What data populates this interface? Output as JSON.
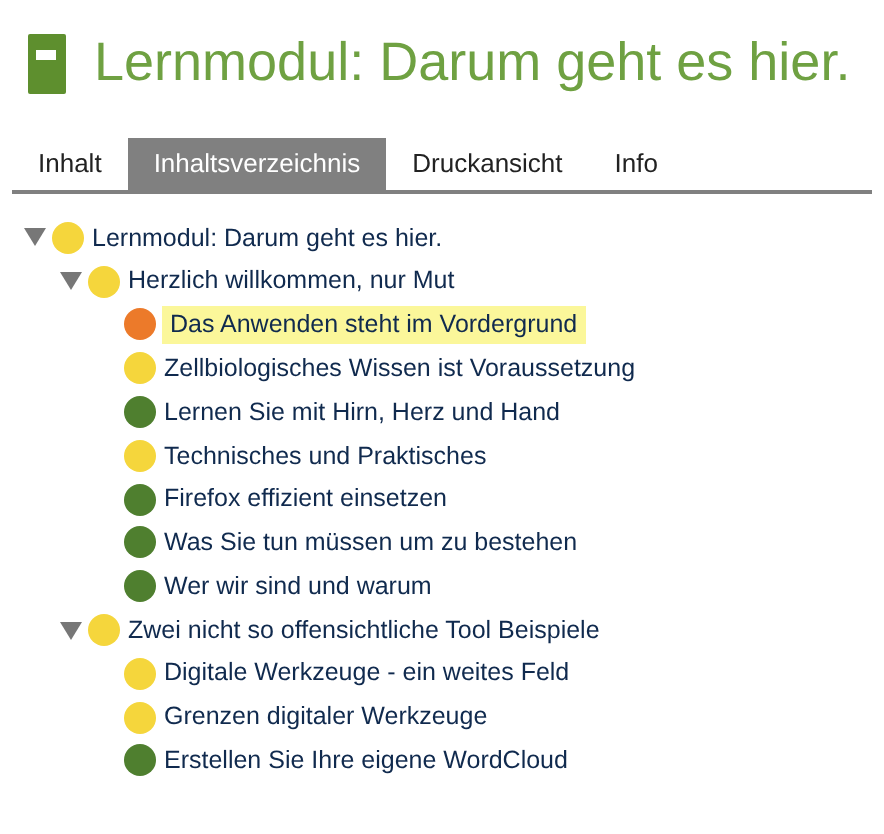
{
  "title": "Lernmodul: Darum geht es hier.",
  "tabs": [
    {
      "label": "Inhalt",
      "selected": false
    },
    {
      "label": "Inhaltsverzeichnis",
      "selected": true
    },
    {
      "label": "Druckansicht",
      "selected": false
    },
    {
      "label": "Info",
      "selected": false
    }
  ],
  "tree": [
    {
      "label": "Lernmodul: Darum geht es hier.",
      "color": "#f5d63c",
      "expanded": true,
      "selected": false,
      "children": [
        {
          "label": "Herzlich willkommen, nur Mut",
          "color": "#f5d63c",
          "expanded": true,
          "selected": false,
          "children": [
            {
              "label": "Das Anwenden steht im Vordergrund",
              "color": "#ec7a2a",
              "selected": true
            },
            {
              "label": "Zellbiologisches Wissen ist Voraussetzung",
              "color": "#f5d63c",
              "selected": false
            },
            {
              "label": "Lernen Sie mit Hirn, Herz und Hand",
              "color": "#4f7f2f",
              "selected": false
            },
            {
              "label": "Technisches und Praktisches",
              "color": "#f5d63c",
              "selected": false
            },
            {
              "label": "Firefox effizient einsetzen",
              "color": "#4f7f2f",
              "selected": false
            },
            {
              "label": "Was Sie tun müssen um zu bestehen",
              "color": "#4f7f2f",
              "selected": false
            },
            {
              "label": "Wer wir sind und warum",
              "color": "#4f7f2f",
              "selected": false
            }
          ]
        },
        {
          "label": "Zwei nicht so offensichtliche Tool Beispiele",
          "color": "#f5d63c",
          "expanded": true,
          "selected": false,
          "children": [
            {
              "label": "Digitale Werkzeuge - ein weites Feld",
              "color": "#f5d63c",
              "selected": false
            },
            {
              "label": "Grenzen digitaler Werkzeuge",
              "color": "#f5d63c",
              "selected": false
            },
            {
              "label": "Erstellen Sie Ihre eigene WordCloud",
              "color": "#4f7f2f",
              "selected": false
            }
          ]
        }
      ]
    }
  ]
}
